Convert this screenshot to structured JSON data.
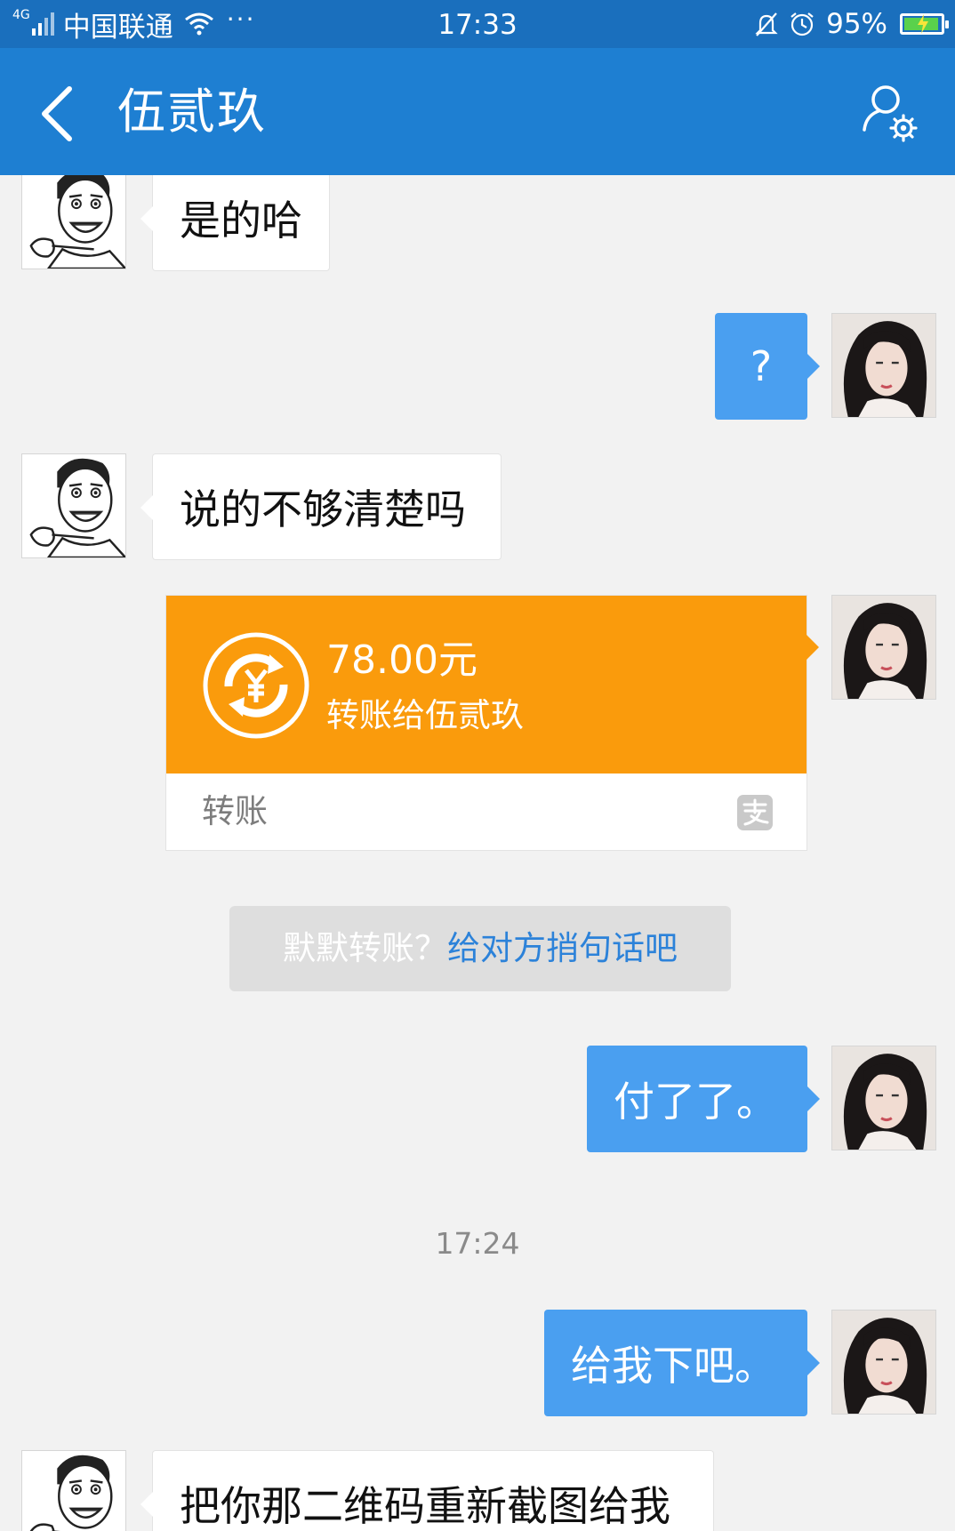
{
  "status_bar": {
    "network_type": "4G",
    "carrier": "中国联通",
    "more": "···",
    "time": "17:33",
    "battery_percent": "95%"
  },
  "header": {
    "title": "伍贰玖"
  },
  "messages": [
    {
      "side": "left",
      "text": "是的哈"
    },
    {
      "side": "right",
      "text": "?"
    },
    {
      "side": "left",
      "text": "说的不够清楚吗"
    },
    {
      "side": "right",
      "type": "transfer",
      "amount": "78.00元",
      "description": "转账给伍贰玖",
      "footer_label": "转账"
    },
    {
      "side": "right",
      "text": "付了了。"
    },
    {
      "side": "right",
      "text": "给我下吧。"
    },
    {
      "side": "left",
      "text": "把你那二维码重新截图给我"
    }
  ],
  "system_note": {
    "prefix": "默默转账？",
    "link": "给对方捎句话吧"
  },
  "timestamp": "17:24",
  "colors": {
    "status_bar": "#1a6fbd",
    "title_bar": "#1e7fd2",
    "right_bubble": "#4a9ff0",
    "transfer_orange": "#fa9b0c",
    "chat_background": "#f2f2f2"
  }
}
